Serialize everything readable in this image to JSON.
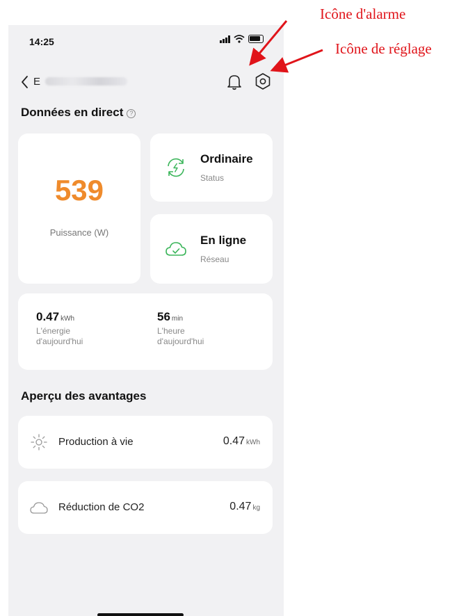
{
  "status_bar": {
    "time": "14:25"
  },
  "nav": {
    "device_prefix": "E"
  },
  "annotations": {
    "alarm_icon": "Icône d'alarme",
    "settings_icon": "Icône de réglage"
  },
  "live": {
    "title": "Données en direct",
    "help_glyph": "?",
    "power": {
      "value": "539",
      "label": "Puissance (W)"
    },
    "status": {
      "value": "Ordinaire",
      "label": "Status"
    },
    "network": {
      "value": "En ligne",
      "label": "Réseau"
    },
    "energy_today": {
      "value": "0.47",
      "unit": "kWh",
      "label": "L'énergie d'aujourd'hui"
    },
    "time_today": {
      "value": "56",
      "unit": "min",
      "label": "L'heure d'aujourd'hui"
    }
  },
  "benefits": {
    "title": "Aperçu des avantages",
    "lifetime_production": {
      "label": "Production à vie",
      "value": "0.47",
      "unit": "kWh"
    },
    "co2_reduction": {
      "label": "Réduction de CO2",
      "value": "0.47",
      "unit": "kg"
    }
  },
  "colors": {
    "accent_orange": "#ef8b2c",
    "icon_green": "#3bb55a",
    "annotation_red": "#e0141a",
    "background": "#f1f1f3"
  }
}
